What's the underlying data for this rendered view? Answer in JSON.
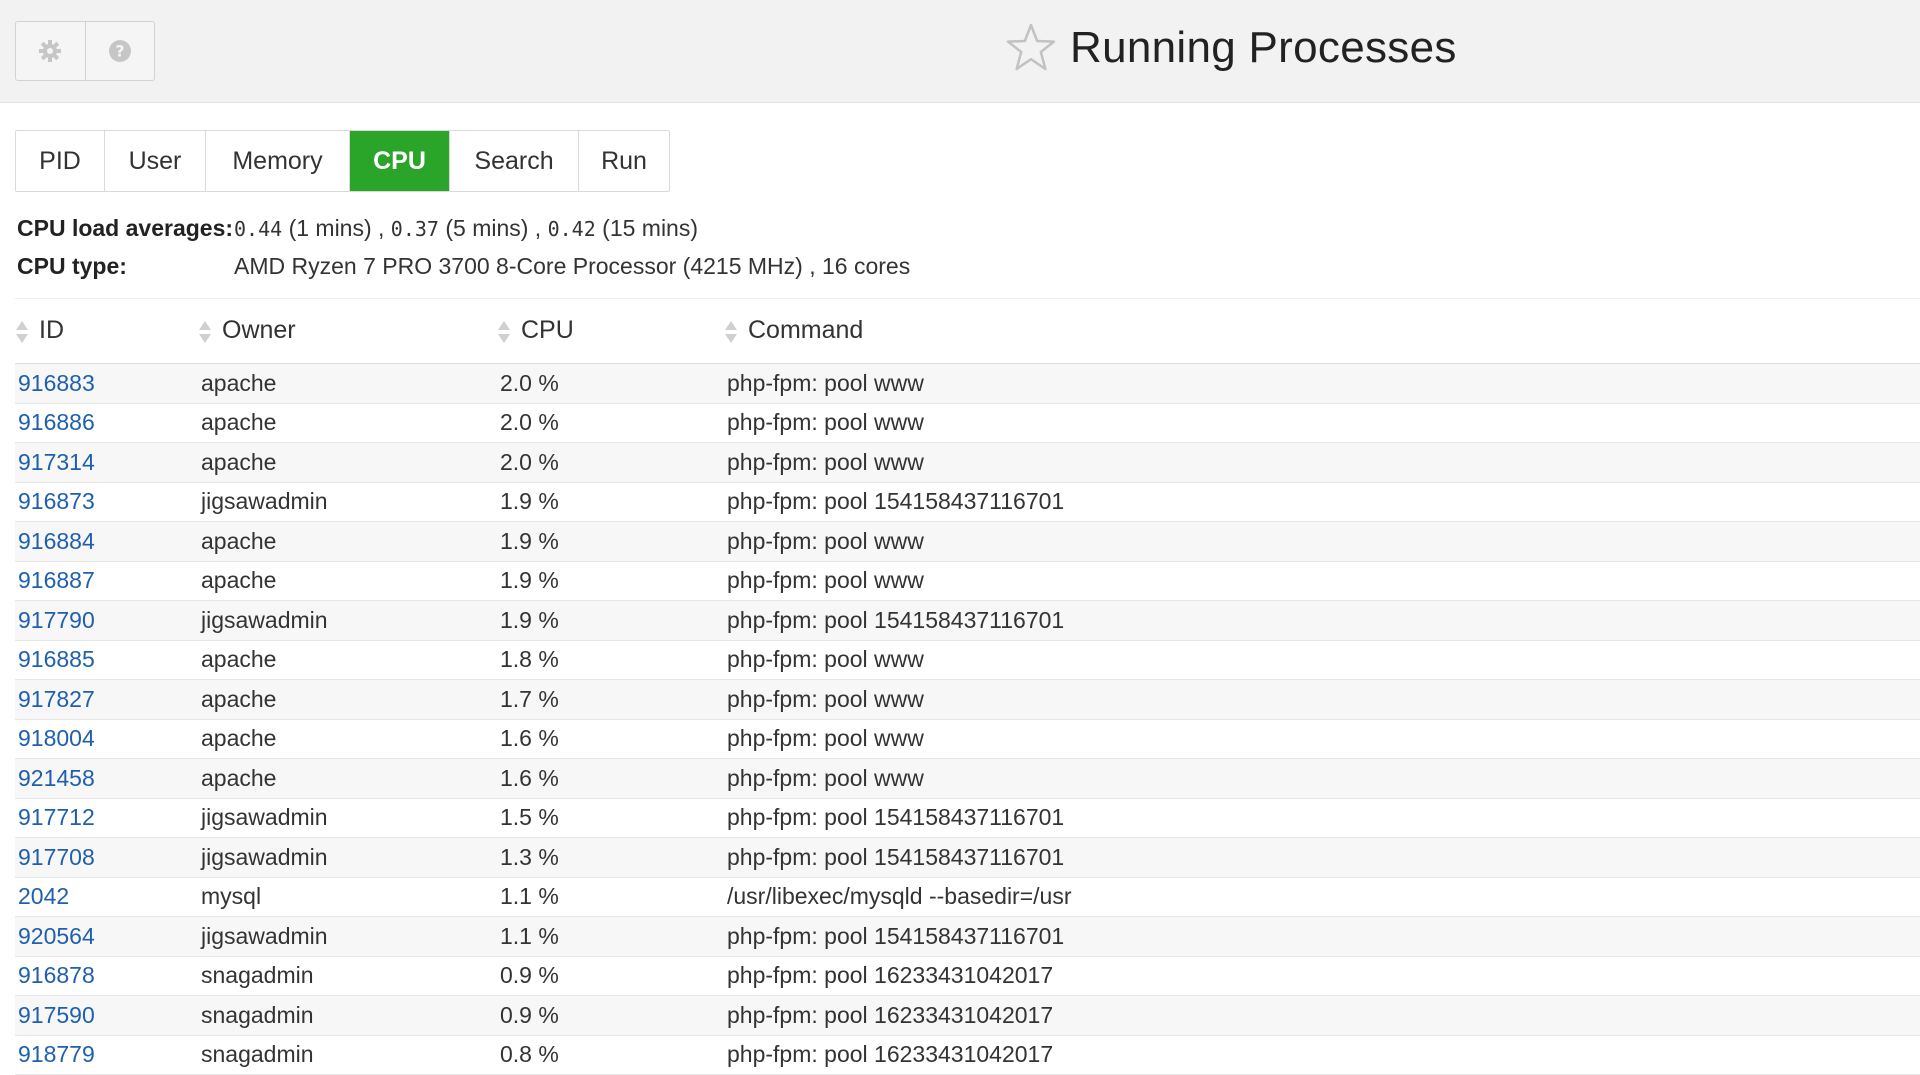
{
  "header": {
    "settings_icon": "gear-icon",
    "help_icon": "question-circle-icon",
    "favorite_icon": "star-outline-icon",
    "title": "Running Processes"
  },
  "tabs": [
    {
      "label": "PID",
      "active": false
    },
    {
      "label": "User",
      "active": false
    },
    {
      "label": "Memory",
      "active": false
    },
    {
      "label": "CPU",
      "active": true
    },
    {
      "label": "Search",
      "active": false
    },
    {
      "label": "Run",
      "active": false
    }
  ],
  "cpu_info": {
    "load_label": "CPU load averages:",
    "load_1": "0.44",
    "load_1_suffix": "(1 mins) ,",
    "load_5": "0.37",
    "load_5_suffix": "(5 mins) ,",
    "load_15": "0.42",
    "load_15_suffix": "(15 mins)",
    "type_label": "CPU type:",
    "type_value": "AMD Ryzen 7 PRO 3700 8-Core Processor (4215 MHz) , 16 cores"
  },
  "table": {
    "columns": [
      "ID",
      "Owner",
      "CPU",
      "Command"
    ],
    "rows": [
      {
        "id": "916883",
        "owner": "apache",
        "cpu": "2.0 %",
        "command": "php-fpm: pool www"
      },
      {
        "id": "916886",
        "owner": "apache",
        "cpu": "2.0 %",
        "command": "php-fpm: pool www"
      },
      {
        "id": "917314",
        "owner": "apache",
        "cpu": "2.0 %",
        "command": "php-fpm: pool www"
      },
      {
        "id": "916873",
        "owner": "jigsawadmin",
        "cpu": "1.9 %",
        "command": "php-fpm: pool 154158437116701"
      },
      {
        "id": "916884",
        "owner": "apache",
        "cpu": "1.9 %",
        "command": "php-fpm: pool www"
      },
      {
        "id": "916887",
        "owner": "apache",
        "cpu": "1.9 %",
        "command": "php-fpm: pool www"
      },
      {
        "id": "917790",
        "owner": "jigsawadmin",
        "cpu": "1.9 %",
        "command": "php-fpm: pool 154158437116701"
      },
      {
        "id": "916885",
        "owner": "apache",
        "cpu": "1.8 %",
        "command": "php-fpm: pool www"
      },
      {
        "id": "917827",
        "owner": "apache",
        "cpu": "1.7 %",
        "command": "php-fpm: pool www"
      },
      {
        "id": "918004",
        "owner": "apache",
        "cpu": "1.6 %",
        "command": "php-fpm: pool www"
      },
      {
        "id": "921458",
        "owner": "apache",
        "cpu": "1.6 %",
        "command": "php-fpm: pool www"
      },
      {
        "id": "917712",
        "owner": "jigsawadmin",
        "cpu": "1.5 %",
        "command": "php-fpm: pool 154158437116701"
      },
      {
        "id": "917708",
        "owner": "jigsawadmin",
        "cpu": "1.3 %",
        "command": "php-fpm: pool 154158437116701"
      },
      {
        "id": "2042",
        "owner": "mysql",
        "cpu": "1.1 %",
        "command": "/usr/libexec/mysqld --basedir=/usr"
      },
      {
        "id": "920564",
        "owner": "jigsawadmin",
        "cpu": "1.1 %",
        "command": "php-fpm: pool 154158437116701"
      },
      {
        "id": "916878",
        "owner": "snagadmin",
        "cpu": "0.9 %",
        "command": "php-fpm: pool 16233431042017"
      },
      {
        "id": "917590",
        "owner": "snagadmin",
        "cpu": "0.9 %",
        "command": "php-fpm: pool 16233431042017"
      },
      {
        "id": "918779",
        "owner": "snagadmin",
        "cpu": "0.8 %",
        "command": "php-fpm: pool 16233431042017"
      }
    ]
  },
  "colors": {
    "active_tab": "#2aa52a",
    "link": "#1f5fae",
    "topbar": "#f2f2f2"
  }
}
